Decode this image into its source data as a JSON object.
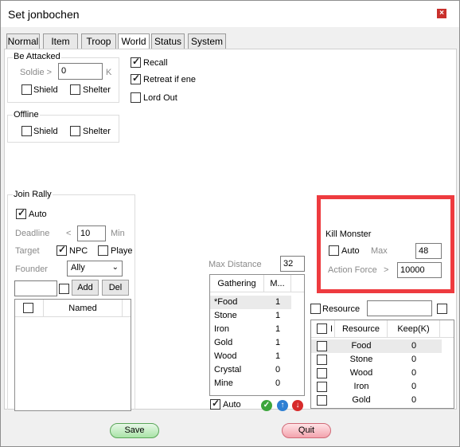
{
  "window": {
    "title": "Set jonbochen",
    "close_glyph": "×"
  },
  "tabs": [
    "Normal",
    "Item",
    "Troop",
    "World",
    "Status",
    "System"
  ],
  "active_tab": "World",
  "be_attacked": {
    "label": "Be Attacked",
    "soldier_label": "Soldie >",
    "soldier_value": "0",
    "soldier_unit": "K",
    "shield_label": "Shield",
    "shield_checked": false,
    "shelter_label": "Shelter",
    "shelter_checked": false
  },
  "recall": {
    "label": "Recall",
    "checked": true
  },
  "retreat": {
    "label": "Retreat if ene",
    "checked": true
  },
  "lord_out": {
    "label": "Lord Out",
    "checked": false
  },
  "offline": {
    "label": "Offline",
    "shield_label": "Shield",
    "shield_checked": false,
    "shelter_label": "Shelter",
    "shelter_checked": false
  },
  "join_rally": {
    "label": "Join Rally",
    "auto_label": "Auto",
    "auto_checked": true,
    "deadline_label": "Deadline",
    "deadline_op": "<",
    "deadline_value": "10",
    "deadline_unit": "Min",
    "target_label": "Target",
    "npc_label": "NPC",
    "npc_checked": true,
    "player_label": "Playe",
    "player_checked": false,
    "founder_label": "Founder",
    "founder_value": "Ally",
    "name_input_value": "",
    "add_label": "Add",
    "del_label": "Del",
    "table_header": "Named"
  },
  "gathering": {
    "max_distance_label": "Max Distance",
    "max_distance_value": "32",
    "col1": "Gathering",
    "col2": "M...",
    "rows": [
      {
        "name": "*Food",
        "val": "1"
      },
      {
        "name": "Stone",
        "val": "1"
      },
      {
        "name": "Iron",
        "val": "1"
      },
      {
        "name": "Gold",
        "val": "1"
      },
      {
        "name": "Wood",
        "val": "1"
      },
      {
        "name": "Crystal",
        "val": "0"
      },
      {
        "name": "Mine",
        "val": "0"
      }
    ],
    "auto_label": "Auto",
    "auto_checked": true
  },
  "kill_monster": {
    "label": "Kill Monster",
    "auto_label": "Auto",
    "auto_checked": false,
    "max_label": "Max",
    "max_value": "48",
    "action_force_label": "Action Force",
    "action_force_op": ">",
    "action_force_value": "10000",
    "highlight_color": "#ee3b3f"
  },
  "resource": {
    "label": "Resource",
    "checked": false,
    "input_value": "",
    "col0": "I",
    "col1": "Resource",
    "col2": "Keep(K)",
    "rows": [
      {
        "name": "Food",
        "keep": "0"
      },
      {
        "name": "Stone",
        "keep": "0"
      },
      {
        "name": "Wood",
        "keep": "0"
      },
      {
        "name": "Iron",
        "keep": "0"
      },
      {
        "name": "Gold",
        "keep": "0"
      }
    ]
  },
  "footer": {
    "save_label": "Save",
    "quit_label": "Quit"
  }
}
